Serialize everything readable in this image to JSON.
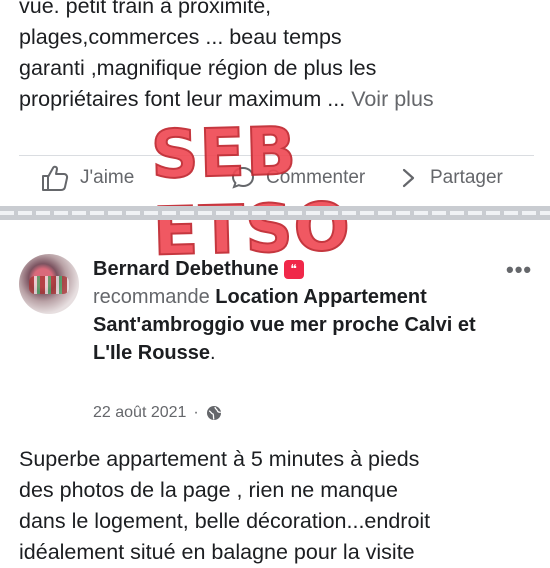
{
  "post1": {
    "lines": [
      "vue. petit train à proximité,",
      "plages,commerces ... beau temps",
      "garanti ,magnifique région de plus les",
      "propriétaires font leur maximum ..."
    ],
    "see_more": "Voir plus"
  },
  "actions": {
    "like": "J'aime",
    "comment": "Commenter",
    "share": "Partager"
  },
  "watermark": "SEB ETSO",
  "post2": {
    "author": "Bernard Debethune",
    "recommends": "recommande",
    "page_name": "Location Appartement Sant'ambroggio vue mer proche Calvi et L'Ile Rousse",
    "page_suffix": ".",
    "date": "22 août 2021",
    "separator": "·",
    "more": "•••",
    "badge_symbol": "❝",
    "review_lines": [
      "Superbe appartement à 5 minutes à pieds",
      "des photos de la page , rien ne manque",
      "dans le logement, belle décoration...endroit",
      "idéalement situé en balagne pour la visite"
    ]
  },
  "icons": {
    "like": "thumbs-up-icon",
    "comment": "comment-icon",
    "share": "share-arrow-icon",
    "globe": "globe-icon",
    "badge": "recommendation-badge-icon",
    "more": "more-options-icon"
  }
}
